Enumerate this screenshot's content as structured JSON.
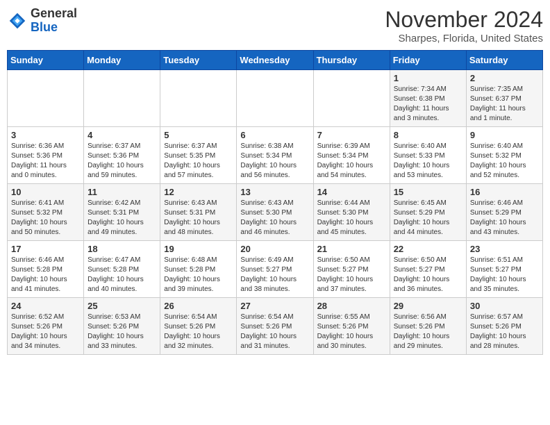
{
  "header": {
    "logo": {
      "line1": "General",
      "line2": "Blue"
    },
    "title": "November 2024",
    "subtitle": "Sharpes, Florida, United States"
  },
  "days_of_week": [
    "Sunday",
    "Monday",
    "Tuesday",
    "Wednesday",
    "Thursday",
    "Friday",
    "Saturday"
  ],
  "weeks": [
    [
      {
        "day": "",
        "info": ""
      },
      {
        "day": "",
        "info": ""
      },
      {
        "day": "",
        "info": ""
      },
      {
        "day": "",
        "info": ""
      },
      {
        "day": "",
        "info": ""
      },
      {
        "day": "1",
        "info": "Sunrise: 7:34 AM\nSunset: 6:38 PM\nDaylight: 11 hours\nand 3 minutes."
      },
      {
        "day": "2",
        "info": "Sunrise: 7:35 AM\nSunset: 6:37 PM\nDaylight: 11 hours\nand 1 minute."
      }
    ],
    [
      {
        "day": "3",
        "info": "Sunrise: 6:36 AM\nSunset: 5:36 PM\nDaylight: 11 hours\nand 0 minutes."
      },
      {
        "day": "4",
        "info": "Sunrise: 6:37 AM\nSunset: 5:36 PM\nDaylight: 10 hours\nand 59 minutes."
      },
      {
        "day": "5",
        "info": "Sunrise: 6:37 AM\nSunset: 5:35 PM\nDaylight: 10 hours\nand 57 minutes."
      },
      {
        "day": "6",
        "info": "Sunrise: 6:38 AM\nSunset: 5:34 PM\nDaylight: 10 hours\nand 56 minutes."
      },
      {
        "day": "7",
        "info": "Sunrise: 6:39 AM\nSunset: 5:34 PM\nDaylight: 10 hours\nand 54 minutes."
      },
      {
        "day": "8",
        "info": "Sunrise: 6:40 AM\nSunset: 5:33 PM\nDaylight: 10 hours\nand 53 minutes."
      },
      {
        "day": "9",
        "info": "Sunrise: 6:40 AM\nSunset: 5:32 PM\nDaylight: 10 hours\nand 52 minutes."
      }
    ],
    [
      {
        "day": "10",
        "info": "Sunrise: 6:41 AM\nSunset: 5:32 PM\nDaylight: 10 hours\nand 50 minutes."
      },
      {
        "day": "11",
        "info": "Sunrise: 6:42 AM\nSunset: 5:31 PM\nDaylight: 10 hours\nand 49 minutes."
      },
      {
        "day": "12",
        "info": "Sunrise: 6:43 AM\nSunset: 5:31 PM\nDaylight: 10 hours\nand 48 minutes."
      },
      {
        "day": "13",
        "info": "Sunrise: 6:43 AM\nSunset: 5:30 PM\nDaylight: 10 hours\nand 46 minutes."
      },
      {
        "day": "14",
        "info": "Sunrise: 6:44 AM\nSunset: 5:30 PM\nDaylight: 10 hours\nand 45 minutes."
      },
      {
        "day": "15",
        "info": "Sunrise: 6:45 AM\nSunset: 5:29 PM\nDaylight: 10 hours\nand 44 minutes."
      },
      {
        "day": "16",
        "info": "Sunrise: 6:46 AM\nSunset: 5:29 PM\nDaylight: 10 hours\nand 43 minutes."
      }
    ],
    [
      {
        "day": "17",
        "info": "Sunrise: 6:46 AM\nSunset: 5:28 PM\nDaylight: 10 hours\nand 41 minutes."
      },
      {
        "day": "18",
        "info": "Sunrise: 6:47 AM\nSunset: 5:28 PM\nDaylight: 10 hours\nand 40 minutes."
      },
      {
        "day": "19",
        "info": "Sunrise: 6:48 AM\nSunset: 5:28 PM\nDaylight: 10 hours\nand 39 minutes."
      },
      {
        "day": "20",
        "info": "Sunrise: 6:49 AM\nSunset: 5:27 PM\nDaylight: 10 hours\nand 38 minutes."
      },
      {
        "day": "21",
        "info": "Sunrise: 6:50 AM\nSunset: 5:27 PM\nDaylight: 10 hours\nand 37 minutes."
      },
      {
        "day": "22",
        "info": "Sunrise: 6:50 AM\nSunset: 5:27 PM\nDaylight: 10 hours\nand 36 minutes."
      },
      {
        "day": "23",
        "info": "Sunrise: 6:51 AM\nSunset: 5:27 PM\nDaylight: 10 hours\nand 35 minutes."
      }
    ],
    [
      {
        "day": "24",
        "info": "Sunrise: 6:52 AM\nSunset: 5:26 PM\nDaylight: 10 hours\nand 34 minutes."
      },
      {
        "day": "25",
        "info": "Sunrise: 6:53 AM\nSunset: 5:26 PM\nDaylight: 10 hours\nand 33 minutes."
      },
      {
        "day": "26",
        "info": "Sunrise: 6:54 AM\nSunset: 5:26 PM\nDaylight: 10 hours\nand 32 minutes."
      },
      {
        "day": "27",
        "info": "Sunrise: 6:54 AM\nSunset: 5:26 PM\nDaylight: 10 hours\nand 31 minutes."
      },
      {
        "day": "28",
        "info": "Sunrise: 6:55 AM\nSunset: 5:26 PM\nDaylight: 10 hours\nand 30 minutes."
      },
      {
        "day": "29",
        "info": "Sunrise: 6:56 AM\nSunset: 5:26 PM\nDaylight: 10 hours\nand 29 minutes."
      },
      {
        "day": "30",
        "info": "Sunrise: 6:57 AM\nSunset: 5:26 PM\nDaylight: 10 hours\nand 28 minutes."
      }
    ]
  ]
}
